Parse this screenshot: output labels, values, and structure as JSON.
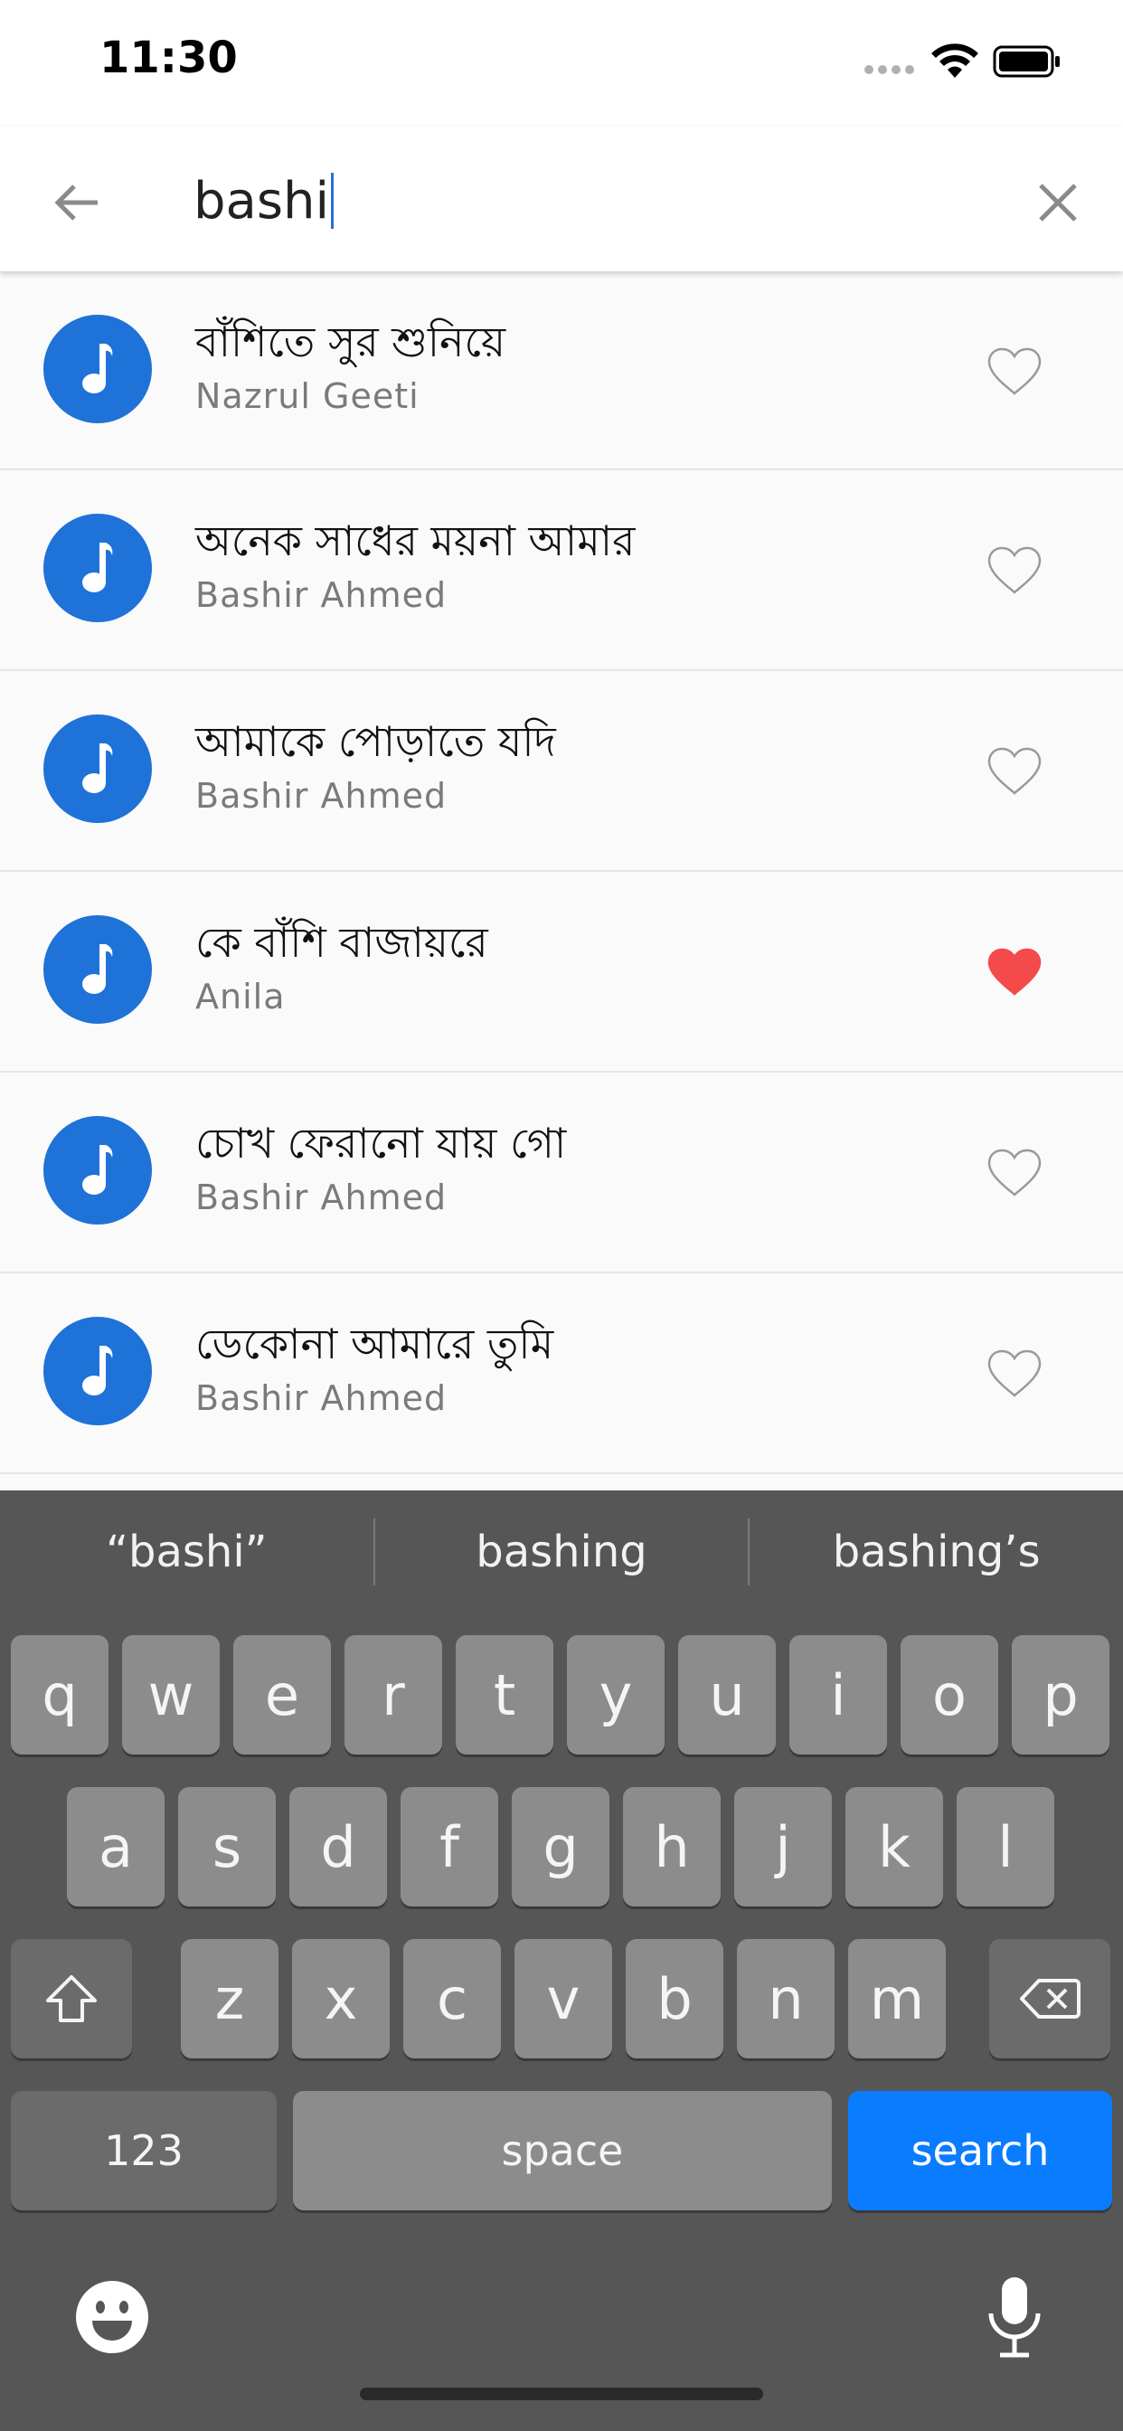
{
  "status_bar": {
    "time": "11:30"
  },
  "search": {
    "query": "bashi"
  },
  "results": [
    {
      "title": "বাঁশিতে সুর শুনিয়ে",
      "artist": "Nazrul Geeti",
      "favorited": false
    },
    {
      "title": "অনেক সাধের ময়না আমার",
      "artist": "Bashir Ahmed",
      "favorited": false
    },
    {
      "title": "আমাকে পোড়াতে যদি",
      "artist": "Bashir Ahmed",
      "favorited": false
    },
    {
      "title": "কে বাঁশি বাজায়রে",
      "artist": "Anila",
      "favorited": true
    },
    {
      "title": "চোখ ফেরানো যায় গো",
      "artist": "Bashir Ahmed",
      "favorited": false
    },
    {
      "title": "ডেকোনা আমারে তুমি",
      "artist": "Bashir Ahmed",
      "favorited": false
    }
  ],
  "keyboard": {
    "suggestions": [
      "“bashi”",
      "bashing",
      "bashing’s"
    ],
    "row1": [
      "q",
      "w",
      "e",
      "r",
      "t",
      "y",
      "u",
      "i",
      "o",
      "p"
    ],
    "row2": [
      "a",
      "s",
      "d",
      "f",
      "g",
      "h",
      "j",
      "k",
      "l"
    ],
    "row3": [
      "z",
      "x",
      "c",
      "v",
      "b",
      "n",
      "m"
    ],
    "numbers_label": "123",
    "space_label": "space",
    "search_label": "search"
  },
  "icons": {
    "back": "arrow-left-icon",
    "clear": "close-icon",
    "song": "music-note-icon",
    "favorite": "heart-icon",
    "shift": "shift-icon",
    "delete": "backspace-icon",
    "emoji": "emoji-icon",
    "mic": "microphone-icon"
  },
  "colors": {
    "accent": "#1e72d8",
    "favorite": "#f44a4a",
    "search_key": "#0a7cff"
  }
}
